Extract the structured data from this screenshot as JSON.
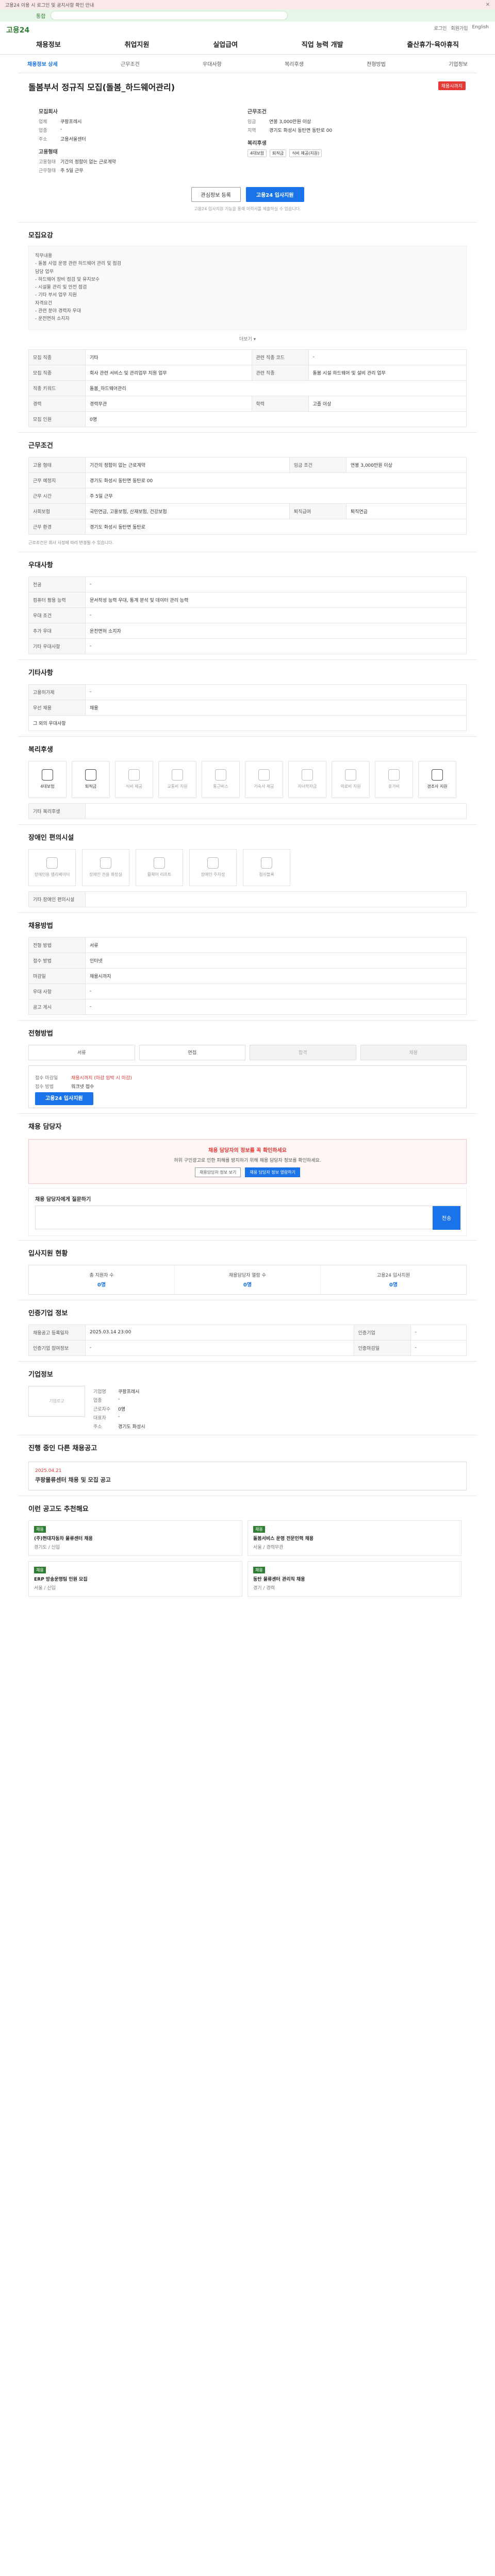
{
  "topbar": {
    "text": "고용24 이용 시 로그인 및 공지사항 확인 안내",
    "close": "✕"
  },
  "search": {
    "scope": "통합",
    "placeholder": ""
  },
  "header": {
    "logo": "고용24",
    "util": [
      "로그인",
      "회원가입",
      "English"
    ],
    "menu": [
      "채용정보",
      "취업지원",
      "실업급여",
      "직업 능력 개발",
      "출산휴가·육아휴직"
    ]
  },
  "tabs": [
    "채용정보 상세",
    "근무조건",
    "우대사항",
    "복리후생",
    "전형방법",
    "기업정보"
  ],
  "job": {
    "title": "돌봄부서 정규직 모집(돌봄_하드웨어관리)",
    "status": "채용시까지",
    "company_label": "모집회사",
    "company": [
      [
        "업체",
        "쿠팡프레시"
      ],
      [
        "업종",
        "-"
      ],
      [
        "주소",
        "고용서울센터"
      ]
    ],
    "conditions_label": "근무조건",
    "conditions": [
      [
        "임금",
        "연봉 3,000만원 이상"
      ],
      [
        "지역",
        "경기도 화성시 동탄면 동탄로 00"
      ]
    ],
    "req_label": "고용형태",
    "req": [
      [
        "고용형태",
        "기간의 정함이 없는 근로계약"
      ],
      [
        "근무형태",
        "주 5일 근무"
      ]
    ],
    "welfare_label": "복리후생",
    "welfare": [
      "4대보험",
      "퇴직금",
      "식비 제공(지원)"
    ],
    "save_btn": "관심정보 등록",
    "apply_btn": "고용24 입사지원",
    "note": "고용24 입사지원 기능을 통해 이력서를 제출하실 수 있습니다."
  },
  "detail": {
    "title": "모집요강",
    "body": "직무내용\n- 돌봄 사업 운영 관련 하드웨어 관리 및 점검\n담당 업무\n- 하드웨어 장비 점검 및 유지보수\n- 시설물 관리 및 안전 점검\n- 기타 부서 업무 지원\n자격요건\n- 관련 분야 경력자 우대\n- 운전면허 소지자",
    "more": "더보기 ▾",
    "rows": [
      [
        "모집 직종",
        "기타",
        "관련 직종 코드",
        "-"
      ],
      [
        "모집 직종",
        "회사 관련 서비스 및 관리업무 지원 업무",
        "관련 직종",
        "돌봄 시설 하드웨어 및 설비 관리 업무"
      ],
      [
        "직종 키워드",
        "돌봄_하드웨어관리",
        "",
        ""
      ],
      [
        "경력",
        "경력무관",
        "학력",
        "고졸 이상"
      ],
      [
        "모집 인원",
        "0명",
        "",
        ""
      ]
    ]
  },
  "work": {
    "title": "근무조건",
    "rows": [
      [
        "고용 형태",
        "기간의 정함이 없는 근로계약",
        "임금 조건",
        "연봉 3,000만원 이상"
      ],
      [
        "근무 예정지",
        "경기도 화성시 동탄면 동탄로 00",
        "",
        ""
      ],
      [
        "근무 시간",
        "주 5일 근무",
        "",
        ""
      ],
      [
        "사회보험",
        "국민연금, 고용보험, 산재보험, 건강보험",
        "퇴직급여",
        "퇴직연금"
      ],
      [
        "근무 환경",
        "경기도 화성시 동탄면 동탄로",
        "",
        ""
      ]
    ],
    "note": "근로조건은 회사 사정에 따라 변경될 수 있습니다."
  },
  "pref": {
    "title": "우대사항",
    "rows": [
      [
        "전공",
        "-"
      ],
      [
        "컴퓨터 활용 능력",
        "문서작성 능력 우대, 통계 분석 및 데이터 관리 능력"
      ],
      [
        "우대 조건",
        "-"
      ],
      [
        "추가 우대",
        "운전면허 소지자"
      ],
      [
        "기타 우대사항",
        "-"
      ]
    ]
  },
  "etc": {
    "title": "기타사항",
    "rows": [
      [
        "고용허가제",
        "-"
      ],
      [
        "우선 채용",
        "채용"
      ]
    ],
    "note": "그 외의 우대사항"
  },
  "benefit": {
    "title": "복리후생",
    "items": [
      {
        "label": "4대보험",
        "on": true
      },
      {
        "label": "퇴직금",
        "on": true
      },
      {
        "label": "식비 제공",
        "on": false
      },
      {
        "label": "교통비 지원",
        "on": false
      },
      {
        "label": "통근버스",
        "on": false
      },
      {
        "label": "기숙사 제공",
        "on": false
      },
      {
        "label": "자녀학자금",
        "on": false
      },
      {
        "label": "의료비 지원",
        "on": false
      },
      {
        "label": "휴가비",
        "on": false
      },
      {
        "label": "경조사 지원",
        "on": true
      }
    ],
    "extra_label": "기타 복리후생"
  },
  "disabled": {
    "title": "장애인 편의시설",
    "items": [
      "장애인용 엘리베이터",
      "장애인 전용 화장실",
      "휠체어 리프트",
      "장애인 주차장",
      "점자블록"
    ],
    "extra_label": "기타 장애인 편의시설"
  },
  "apply": {
    "title": "채용방법",
    "rows": [
      [
        "전형 방법",
        "서류"
      ],
      [
        "접수 방법",
        "인터넷"
      ],
      [
        "마감일",
        "채용시까지"
      ],
      [
        "우대 사항",
        "-"
      ],
      [
        "공고 게시",
        "-"
      ]
    ],
    "title2": "전형방법",
    "steps": [
      "서류",
      "면접",
      "합격",
      "채용"
    ],
    "deadline_label": "접수 마감일",
    "deadline": "채용시까지 (마감 임박 시 마감)",
    "method_label": "접수 방법",
    "method": "워크넷 접수",
    "btn": "고용24 입사지원"
  },
  "notice": {
    "title": "채용 담당자",
    "t": "채용 담당자의 정보를 꼭 확인하세요",
    "body": "허위 구인광고로 인한 피해를 방지하기 위해 채용 담당자 정보를 확인하세요.",
    "b1": "채용담당자 정보 보기",
    "b2": "채용 담당자 정보 열람하기"
  },
  "qa": {
    "title": "채용 담당자에게 질문하기",
    "placeholder": "질문 내용을 입력해 주세요.",
    "send": "전송"
  },
  "stats": {
    "title": "입사지원 현황",
    "cells": [
      [
        "총 지원자 수",
        "0명"
      ],
      [
        "채용담당자 열람 수",
        "0명"
      ],
      [
        "고용24 입사지원",
        "0명"
      ]
    ]
  },
  "info": {
    "title": "인증기업 정보",
    "rows": [
      [
        "채용공고 등록일자",
        "2025.03.14 23:00",
        "인증기업",
        "-"
      ],
      [
        "인증기업 참여정보",
        "-",
        "인증마감일",
        "-"
      ]
    ]
  },
  "company": {
    "title": "기업정보",
    "logo": "기업로고",
    "rows": [
      [
        "기업명",
        "쿠팡프레시"
      ],
      [
        "업종",
        "-"
      ],
      [
        "근로자수",
        "0명"
      ],
      [
        "대표자",
        "-"
      ],
      [
        "주소",
        "경기도 화성시"
      ]
    ]
  },
  "similar": {
    "title": "진행 중인 다른 채용공고",
    "date": "2025.04.21",
    "ttl": "쿠팡물류센터 채용 및 모집 공고"
  },
  "rec": {
    "title": "이런 공고도 추천해요",
    "cards": [
      {
        "tag": "채용",
        "ttl": "(주)현대자동차 물류센터 채용",
        "meta": "경기도 / 신입"
      },
      {
        "tag": "채용",
        "ttl": "돌봄서비스 운영 전문인력 채용",
        "meta": "서울 / 경력무관"
      },
      {
        "tag": "채용",
        "ttl": "ERP 방송운영팀 인원 모집",
        "meta": "서울 / 신입"
      },
      {
        "tag": "채용",
        "ttl": "동탄 물류센터 관리직 채용",
        "meta": "경기 / 경력"
      }
    ]
  }
}
